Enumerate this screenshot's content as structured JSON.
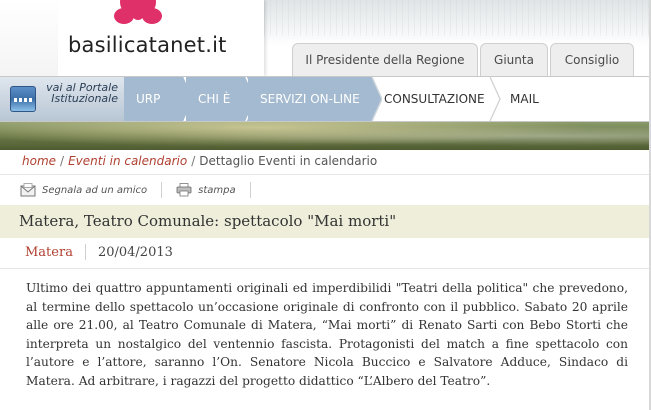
{
  "header": {
    "site_name": "basilicatanet.it",
    "tabs": [
      {
        "label": "Il Presidente della Regione"
      },
      {
        "label": "Giunta"
      },
      {
        "label": "Consiglio"
      }
    ]
  },
  "nav": {
    "portal_label": "vai al Portale Istituzionale",
    "items": [
      {
        "label": "URP"
      },
      {
        "label": "CHI È"
      },
      {
        "label": "SERVIZI ON-LINE"
      },
      {
        "label": "CONSULTAZIONE"
      },
      {
        "label": "MAIL"
      }
    ]
  },
  "breadcrumb": {
    "home": "home",
    "events": "Eventi in calendario",
    "current": "Dettaglio Eventi in calendario"
  },
  "actions": {
    "share": "Segnala ad un amico",
    "print": "stampa"
  },
  "article": {
    "title": "Matera, Teatro Comunale: spettacolo \"Mai morti\"",
    "place": "Matera",
    "date": "20/04/2013",
    "body": "Ultimo dei quattro appuntamenti originali ed imperdibilidi \"Teatri della politica\" che prevedono, al termine dello spettacolo un’occasione originale di confronto con il pubblico. Sabato 20 aprile alle ore 21.00, al Teatro Comunale di Matera, “Mai morti” di Renato Sarti con Bebo Storti che interpreta un nostalgico del ventennio fascista. Protagonisti del match a fine spettacolo con l’autore e l’attore, saranno l’On. Senatore Nicola Buccico e Salvatore Adduce, Sindaco di Matera. Ad arbitrare, i ragazzi del progetto didattico “L’Albero del Teatro”."
  },
  "colors": {
    "accent": "#b04030",
    "nav_blue": "#a3bad0",
    "title_bg": "#eeeedb",
    "logo_flower": "#e0306a"
  }
}
